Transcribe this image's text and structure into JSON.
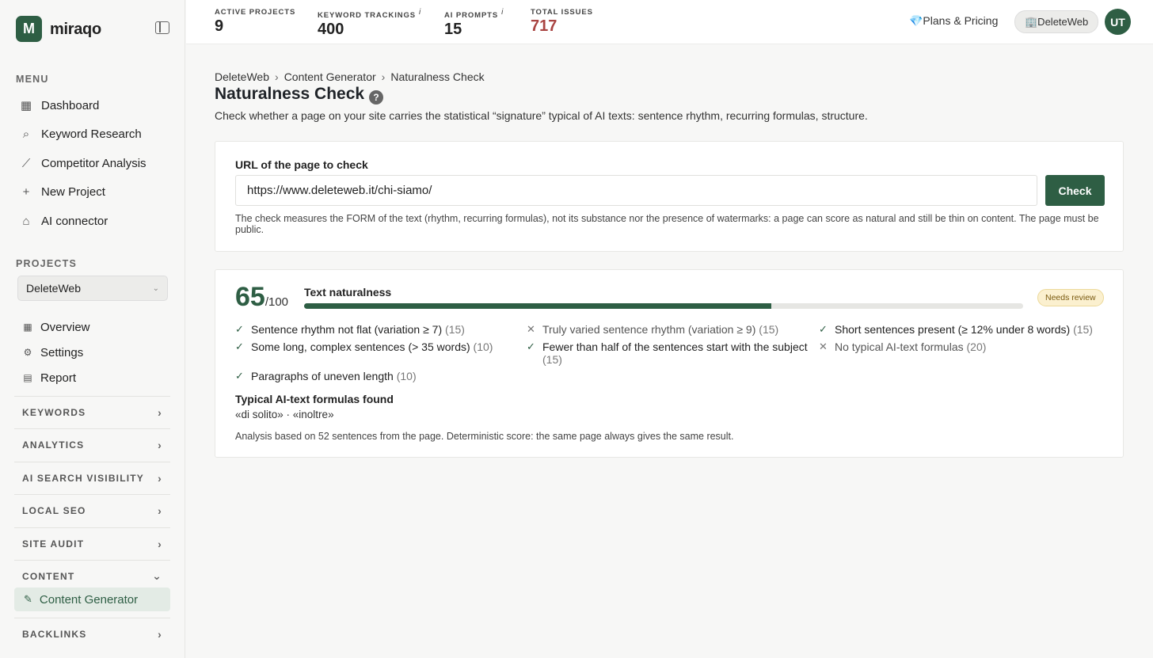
{
  "sidebar": {
    "logo_letter": "M",
    "brand": "miraqo",
    "menu_label": "MENU",
    "menu": [
      {
        "label": "Dashboard",
        "icon": "grid-icon"
      },
      {
        "label": "Keyword Research",
        "icon": "search-icon"
      },
      {
        "label": "Competitor Analysis",
        "icon": "chart-line-icon"
      },
      {
        "label": "New Project",
        "icon": "plus-icon"
      },
      {
        "label": "AI connector",
        "icon": "robot-icon"
      }
    ],
    "projects_label": "PROJECTS",
    "project_selected": "DeleteWeb",
    "project_items": [
      {
        "label": "Overview",
        "icon": "grid-icon"
      },
      {
        "label": "Settings",
        "icon": "gear-icon"
      },
      {
        "label": "Report",
        "icon": "document-icon"
      }
    ],
    "groups": [
      "KEYWORDS",
      "ANALYTICS",
      "AI SEARCH VISIBILITY",
      "LOCAL SEO",
      "SITE AUDIT",
      "CONTENT",
      "BACKLINKS"
    ],
    "active_item": "Content Generator"
  },
  "topbar": {
    "stats": [
      {
        "label": "ACTIVE PROJECTS",
        "value": "9",
        "info": ""
      },
      {
        "label": "KEYWORD TRACKINGS",
        "value": "400",
        "info": "i"
      },
      {
        "label": "AI PROMPTS",
        "value": "15",
        "info": "i"
      },
      {
        "label": "TOTAL ISSUES",
        "value": "717",
        "info": ""
      }
    ],
    "plans": "💎Plans & Pricing",
    "workspace": "🏢DeleteWeb",
    "avatar": "UT"
  },
  "breadcrumbs": [
    "DeleteWeb",
    "Content Generator",
    "Naturalness Check"
  ],
  "page_title": "Naturalness Check",
  "page_subtitle": "Check whether a page on your site carries the statistical “signature” typical of AI texts: sentence rhythm, recurring formulas, structure.",
  "form": {
    "label": "URL of the page to check",
    "url_value": "https://www.deleteweb.it/chi-siamo/",
    "check_label": "Check",
    "hint": "The check measures the FORM of the text (rhythm, recurring formulas), not its substance nor the presence of watermarks: a page can score as natural and still be thin on content. The page must be public."
  },
  "result": {
    "score": "65",
    "score_max": "/100",
    "score_value": 65,
    "metric_label": "Text naturalness",
    "badge": "Needs review",
    "criteria": [
      {
        "text": "Sentence rhythm not flat (variation ≥ 7)",
        "points": "(15)",
        "passed": true
      },
      {
        "text": "Truly varied sentence rhythm (variation ≥ 9)",
        "points": "(15)",
        "passed": false
      },
      {
        "text": "Short sentences present (≥ 12% under 8 words)",
        "points": "(15)",
        "passed": true
      },
      {
        "text": "Some long, complex sentences (> 35 words)",
        "points": "(10)",
        "passed": true
      },
      {
        "text": "Fewer than half of the sentences start with the subject",
        "points": "(15)",
        "passed": true
      },
      {
        "text": "No typical AI-text formulas",
        "points": "(20)",
        "passed": false
      },
      {
        "text": "Paragraphs of uneven length",
        "points": "(10)",
        "passed": true
      }
    ],
    "found_title": "Typical AI-text formulas found",
    "found_list": "«di solito» · «inoltre»",
    "footnote": "Analysis based on 52 sentences from the page. Deterministic score: the same page always gives the same result."
  },
  "colors": {
    "accent": "#2e5e44",
    "issues": "#a94442",
    "badge_bg": "#fbf0cf"
  }
}
